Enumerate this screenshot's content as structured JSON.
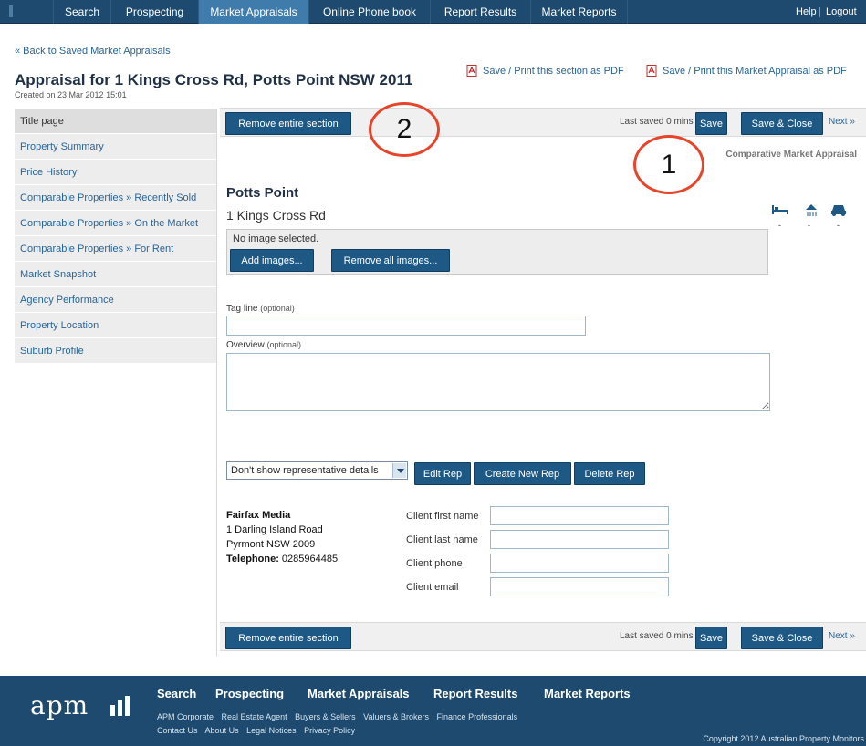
{
  "topnav": {
    "items": [
      "Search",
      "Prospecting",
      "Market Appraisals",
      "Online Phone book",
      "Report Results",
      "Market Reports"
    ],
    "active_index": 2,
    "help": "Help",
    "logout": "Logout"
  },
  "back_link": "« Back to Saved Market Appraisals",
  "page_title": "Appraisal for 1 Kings Cross Rd, Potts Point NSW 2011",
  "created": "Created on 23 Mar 2012 15:01",
  "pdf": {
    "section": "Save / Print this section as PDF",
    "appraisal": "Save / Print this Market Appraisal as PDF"
  },
  "sidebar": {
    "items": [
      "Title page",
      "Property Summary",
      "Price History",
      "Comparable Properties » Recently Sold",
      "Comparable Properties » On the Market",
      "Comparable Properties » For Rent",
      "Market Snapshot",
      "Agency Performance",
      "Property Location",
      "Suburb Profile"
    ],
    "active_index": 0
  },
  "toolbar": {
    "remove_section": "Remove entire section",
    "last_saved": "Last saved 0 mins ago",
    "save": "Save",
    "save_close": "Save & Close",
    "next": "Next »"
  },
  "annotations": {
    "one": "1",
    "two": "2"
  },
  "section_label": "Comparative Market Appraisal",
  "property": {
    "suburb": "Potts Point",
    "address": "1 Kings Cross Rd",
    "features": {
      "bed_icon": "bed-icon",
      "bath_icon": "shower-icon",
      "car_icon": "car-icon",
      "values": [
        "-",
        "-",
        "-"
      ]
    }
  },
  "images": {
    "none_text": "No image selected.",
    "add": "Add images...",
    "remove_all": "Remove all images..."
  },
  "fields": {
    "tagline_label": "Tag line",
    "tagline_hint": "(optional)",
    "tagline_value": "",
    "overview_label": "Overview",
    "overview_hint": "(optional)",
    "overview_value": ""
  },
  "representative": {
    "select_value": "Don't show representative details",
    "edit": "Edit Rep",
    "create": "Create New Rep",
    "delete": "Delete Rep",
    "company": "Fairfax Media",
    "address1": "1 Darling Island Road",
    "address2": "Pyrmont NSW 2009",
    "telephone_label": "Telephone:",
    "telephone": " 0285964485"
  },
  "client": {
    "first_name_label": "Client first name",
    "last_name_label": "Client last name",
    "phone_label": "Client phone",
    "email_label": "Client email",
    "first_name": "",
    "last_name": "",
    "phone": "",
    "email": ""
  },
  "footer": {
    "brand": "apm",
    "nav": [
      "Search",
      "Prospecting",
      "Market Appraisals",
      "Report Results",
      "Market Reports"
    ],
    "links_row1": [
      "APM Corporate",
      "Real Estate Agent",
      "Buyers & Sellers",
      "Valuers & Brokers",
      "Finance Professionals"
    ],
    "links_row2": [
      "Contact Us",
      "About Us",
      "Legal Notices",
      "Privacy Policy"
    ],
    "copyright": "Copyright 2012 Australian Property Monitors"
  },
  "colors": {
    "nav_bg": "#1d4a6e",
    "nav_active": "#3f7cab",
    "button": "#1e5985",
    "link": "#2a6496",
    "annotation": "#e8442a"
  }
}
